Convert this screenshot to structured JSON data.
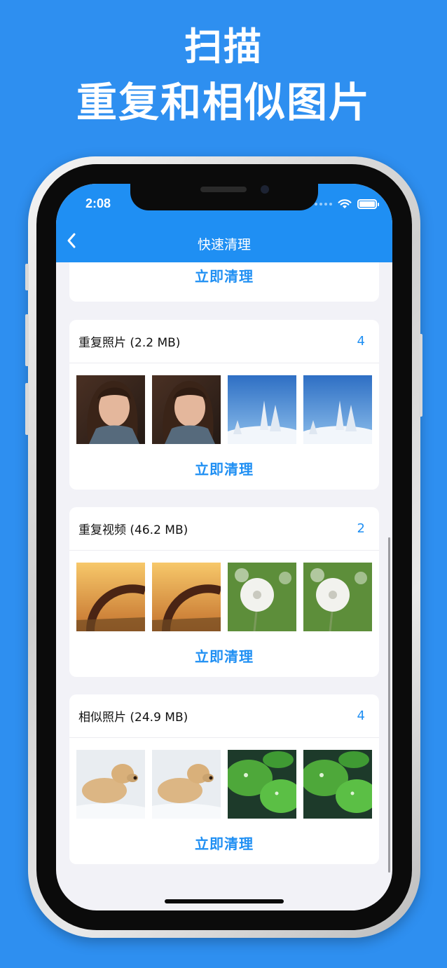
{
  "headline": {
    "line1": "扫描",
    "line2": "重复和相似图片"
  },
  "status_bar": {
    "time": "2:08"
  },
  "nav": {
    "title": "快速清理",
    "back_icon": "chevron-left-icon"
  },
  "cards": [
    {
      "type": "partial",
      "button_label": "立即清理"
    },
    {
      "title": "重复照片 (2.2 MB)",
      "count": "4",
      "button_label": "立即清理",
      "thumbnails": [
        "girl-portrait",
        "girl-portrait",
        "snow-trees",
        "snow-trees"
      ]
    },
    {
      "title": "重复视频 (46.2 MB)",
      "count": "2",
      "button_label": "立即清理",
      "thumbnails": [
        "sunset-wheel",
        "sunset-wheel",
        "dandelion",
        "dandelion"
      ]
    },
    {
      "title": "相似照片 (24.9 MB)",
      "count": "4",
      "button_label": "立即清理",
      "thumbnails": [
        "dog-in-snow",
        "dog-in-snow",
        "lily-pads",
        "lily-pads"
      ]
    }
  ],
  "colors": {
    "background": "#2e8ff0",
    "accent": "#1f8ff3",
    "screen_bg": "#f2f2f7"
  }
}
